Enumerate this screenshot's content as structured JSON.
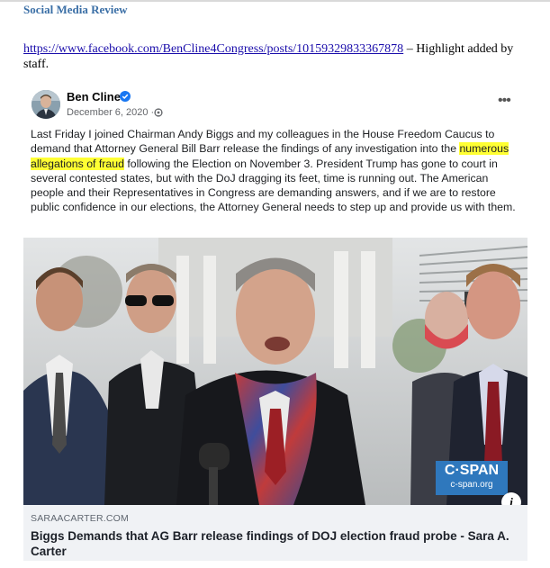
{
  "document": {
    "section_header": "Social Media Review",
    "source_url": "https://www.facebook.com/BenCline4Congress/posts/10159329833367878",
    "source_note": " – Highlight added by staff."
  },
  "post": {
    "author": "Ben Cline",
    "date": "December 6, 2020 · ",
    "text_before_highlight": "Last Friday I joined Chairman Andy Biggs and my colleagues in the House Freedom Caucus to demand that Attorney General Bill Barr release the findings of any investigation into the ",
    "highlighted_text": "numerous allegations of fraud",
    "text_after_highlight": " following the Election on November 3.  President Trump has gone to court in several contested states, but with the DoJ dragging its feet, time is running out.  The American people and their Representatives in Congress are demanding answers, and if we are to restore public confidence in our elections, the Attorney General needs to step up and provide us with them.",
    "highlight_color": "#ffff33"
  },
  "link_preview": {
    "domain": "SARAACARTER.COM",
    "title": "Biggs Demands that AG Barr release findings of DOJ election fraud probe - Sara A. Carter",
    "image_logo_main": "C·SPAN",
    "image_logo_sub": "c-span.org"
  },
  "icons": {
    "verified": "verified-badge-icon",
    "privacy": "globe-icon",
    "more": "more-options-icon",
    "info": "info-icon"
  },
  "colors": {
    "header_blue": "#3b6fa6",
    "link_blue": "#1a0dab",
    "facebook_blue": "#1877f2",
    "cspan_blue": "#2f78bd"
  }
}
